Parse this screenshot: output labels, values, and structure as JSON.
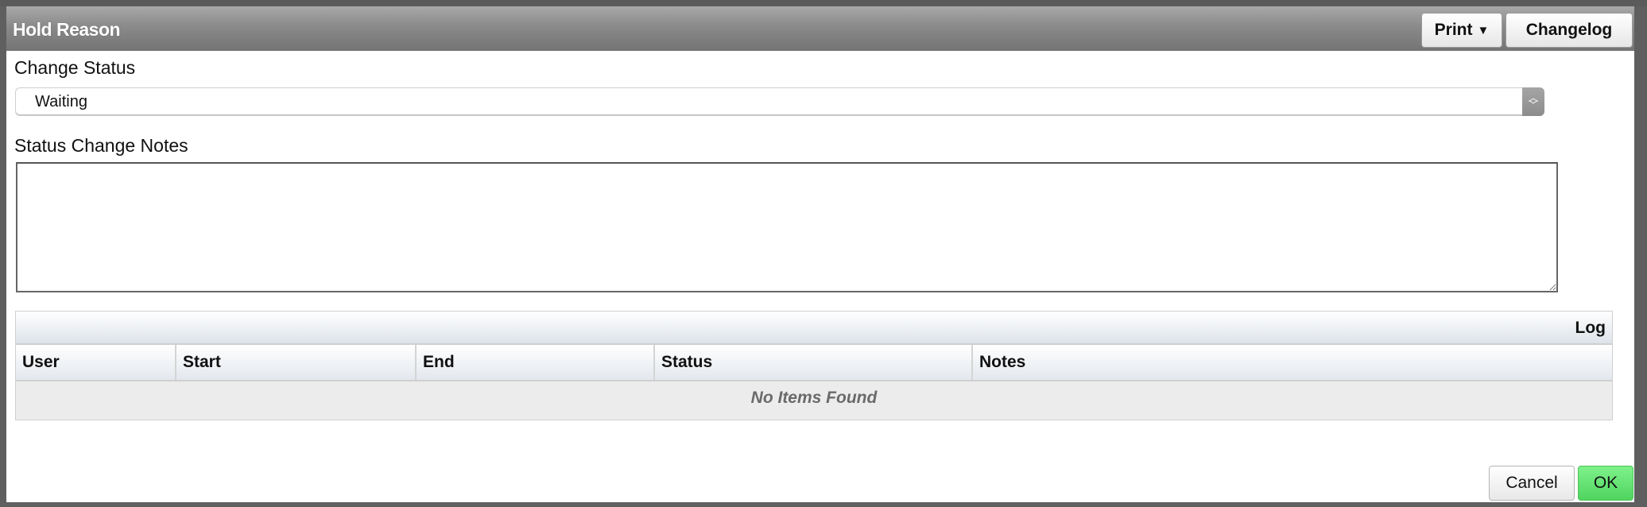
{
  "dialog": {
    "title": "Hold Reason",
    "print_label": "Print",
    "print_caret": "▼",
    "changelog_label": "Changelog"
  },
  "form": {
    "status_label": "Change Status",
    "status_value": "Waiting",
    "notes_label": "Status Change Notes",
    "notes_value": "",
    "notes_placeholder": ""
  },
  "log": {
    "title": "Log",
    "columns": [
      "User",
      "Start",
      "End",
      "Status",
      "Notes"
    ],
    "rows": [],
    "empty_message": "No Items Found"
  },
  "footer": {
    "cancel_label": "Cancel",
    "ok_label": "OK"
  },
  "colors": {
    "ok_button": "#5fe06e",
    "titlebar": "#8a8a8a"
  }
}
